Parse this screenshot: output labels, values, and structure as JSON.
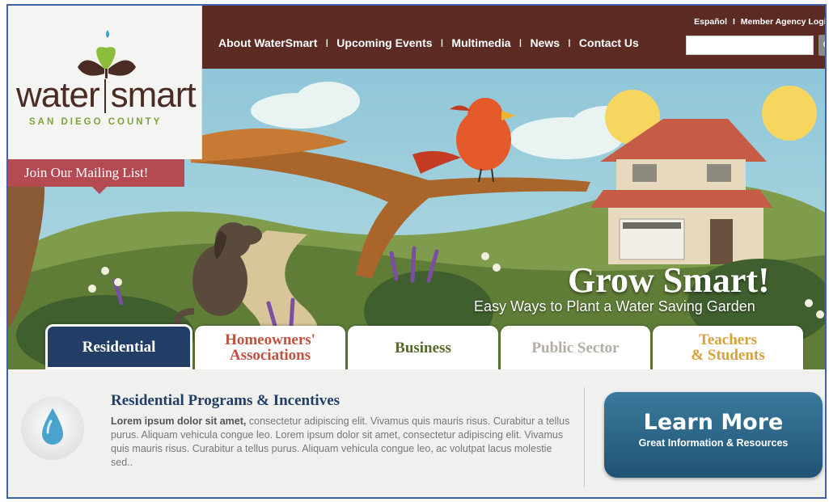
{
  "brand": {
    "word_left": "water",
    "word_right": "smart",
    "subtitle": "SAN DIEGO COUNTY",
    "mailing_label": "Join Our Mailing List!"
  },
  "utility": {
    "espanol": "Español",
    "sep": "I",
    "member_login": "Member Agency Login"
  },
  "nav": {
    "items": [
      "About WaterSmart",
      "Upcoming Events",
      "Multimedia",
      "News",
      "Contact Us"
    ],
    "sep": "I"
  },
  "search": {
    "value": "",
    "placeholder": ""
  },
  "hero": {
    "title": "Grow Smart!",
    "subtitle": "Easy Ways to Plant a Water Saving Garden"
  },
  "tabs": [
    {
      "label_line1": "Residential",
      "label_line2": "",
      "color": "#ffffff",
      "active": true
    },
    {
      "label_line1": "Homeowners'",
      "label_line2": "Associations",
      "color": "#c0523f",
      "active": false
    },
    {
      "label_line1": "Business",
      "label_line2": "",
      "color": "#55692b",
      "active": false
    },
    {
      "label_line1": "Public Sector",
      "label_line2": "",
      "color": "#b3ada4",
      "active": false
    },
    {
      "label_line1": "Teachers",
      "label_line2": "& Students",
      "color": "#d9a13a",
      "active": false
    }
  ],
  "program": {
    "title": "Residential Programs & Incentives",
    "lead": "Lorem ipsum dolor sit amet,",
    "body": " consectetur adipiscing elit. Vivamus quis mauris risus. Curabitur a tellus purus. Aliquam vehicula congue leo. Lorem ipsum dolor sit amet, consectetur adipiscing elit. Vivamus quis mauris risus. Curabitur a tellus purus. Aliquam vehicula congue leo, ac volutpat lacus molestie sed.."
  },
  "cta": {
    "title": "Learn More",
    "subtitle": "Great Information & Resources"
  },
  "colors": {
    "topbar": "#5c2b24",
    "brand_brown": "#4a2c25",
    "brand_green": "#7da23b",
    "mailing_red": "#b64a52",
    "tab_active": "#233e66",
    "cta_blue": "#2c6688"
  }
}
